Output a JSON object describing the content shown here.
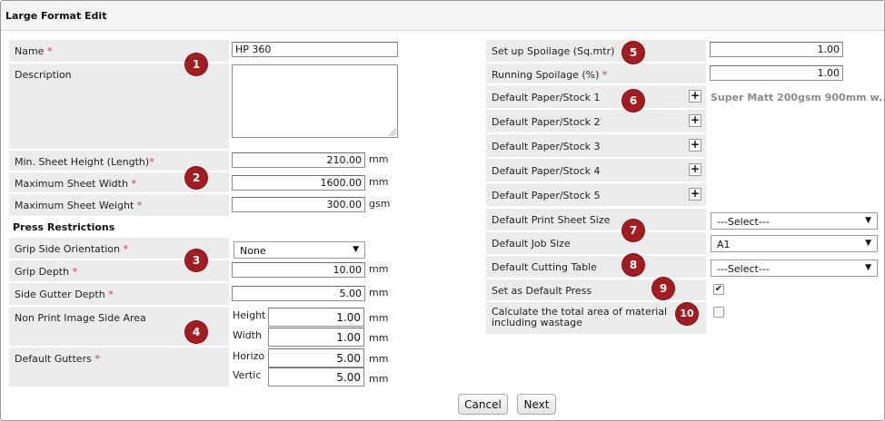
{
  "window": {
    "title": "Large Format Edit"
  },
  "left": {
    "name_label": "Name",
    "name_value": "HP 360",
    "description_label": "Description",
    "description_value": "",
    "min_sheet_height_label": "Min. Sheet Height (Length)",
    "min_sheet_height_value": "210.00",
    "min_sheet_height_unit": "mm",
    "max_sheet_width_label": "Maximum Sheet Width",
    "max_sheet_width_value": "1600.00",
    "max_sheet_width_unit": "mm",
    "max_sheet_weight_label": "Maximum Sheet Weight",
    "max_sheet_weight_value": "300.00",
    "max_sheet_weight_unit": "gsm",
    "press_restrictions_heading": "Press Restrictions",
    "grip_side_label": "Grip Side Orientation",
    "grip_side_value": "None",
    "grip_depth_label": "Grip Depth",
    "grip_depth_value": "10.00",
    "grip_depth_unit": "mm",
    "side_gutter_label": "Side Gutter Depth",
    "side_gutter_value": "5.00",
    "side_gutter_unit": "mm",
    "non_print_label": "Non Print Image Side Area",
    "non_print_height_label": "Height",
    "non_print_height_value": "1.00",
    "non_print_height_unit": "mm",
    "non_print_width_label": "Width",
    "non_print_width_value": "1.00",
    "non_print_width_unit": "mm",
    "default_gutters_label": "Default Gutters",
    "gutters_horiz_label": "Horizo",
    "gutters_horiz_value": "5.00",
    "gutters_horiz_unit": "mm",
    "gutters_vert_label": "Vertic",
    "gutters_vert_value": "5.00",
    "gutters_vert_unit": "mm"
  },
  "right": {
    "setup_spoilage_label": "Set up Spoilage (Sq.mtr)",
    "setup_spoilage_value": "1.00",
    "running_spoilage_label": "Running Spoilage (%)",
    "running_spoilage_value": "1.00",
    "stock1_label": "Default Paper/Stock 1",
    "stock1_value": "Super Matt 200gsm 900mm w...",
    "stock2_label": "Default Paper/Stock 2",
    "stock3_label": "Default Paper/Stock 3",
    "stock4_label": "Default Paper/Stock 4",
    "stock5_label": "Default Paper/Stock 5",
    "print_sheet_size_label": "Default Print Sheet Size",
    "print_sheet_size_value": "---Select---",
    "job_size_label": "Default Job Size",
    "job_size_value": "A1",
    "cutting_table_label": "Default Cutting Table",
    "cutting_table_value": "---Select---",
    "default_press_label": "Set as Default Press",
    "default_press_checked": true,
    "calc_area_label": "Calculate the total area of material including wastage",
    "calc_area_checked": false
  },
  "required_marker": "*",
  "plus_glyph": "+",
  "check_glyph": "✔",
  "dropdown_glyph": "▼",
  "badges": [
    "1",
    "2",
    "3",
    "4",
    "5",
    "6",
    "7",
    "8",
    "9",
    "10"
  ],
  "buttons": {
    "cancel": "Cancel",
    "next": "Next"
  },
  "colors": {
    "badge": "#a11d22",
    "label_bg": "#ececec",
    "required": "#d9343a"
  }
}
